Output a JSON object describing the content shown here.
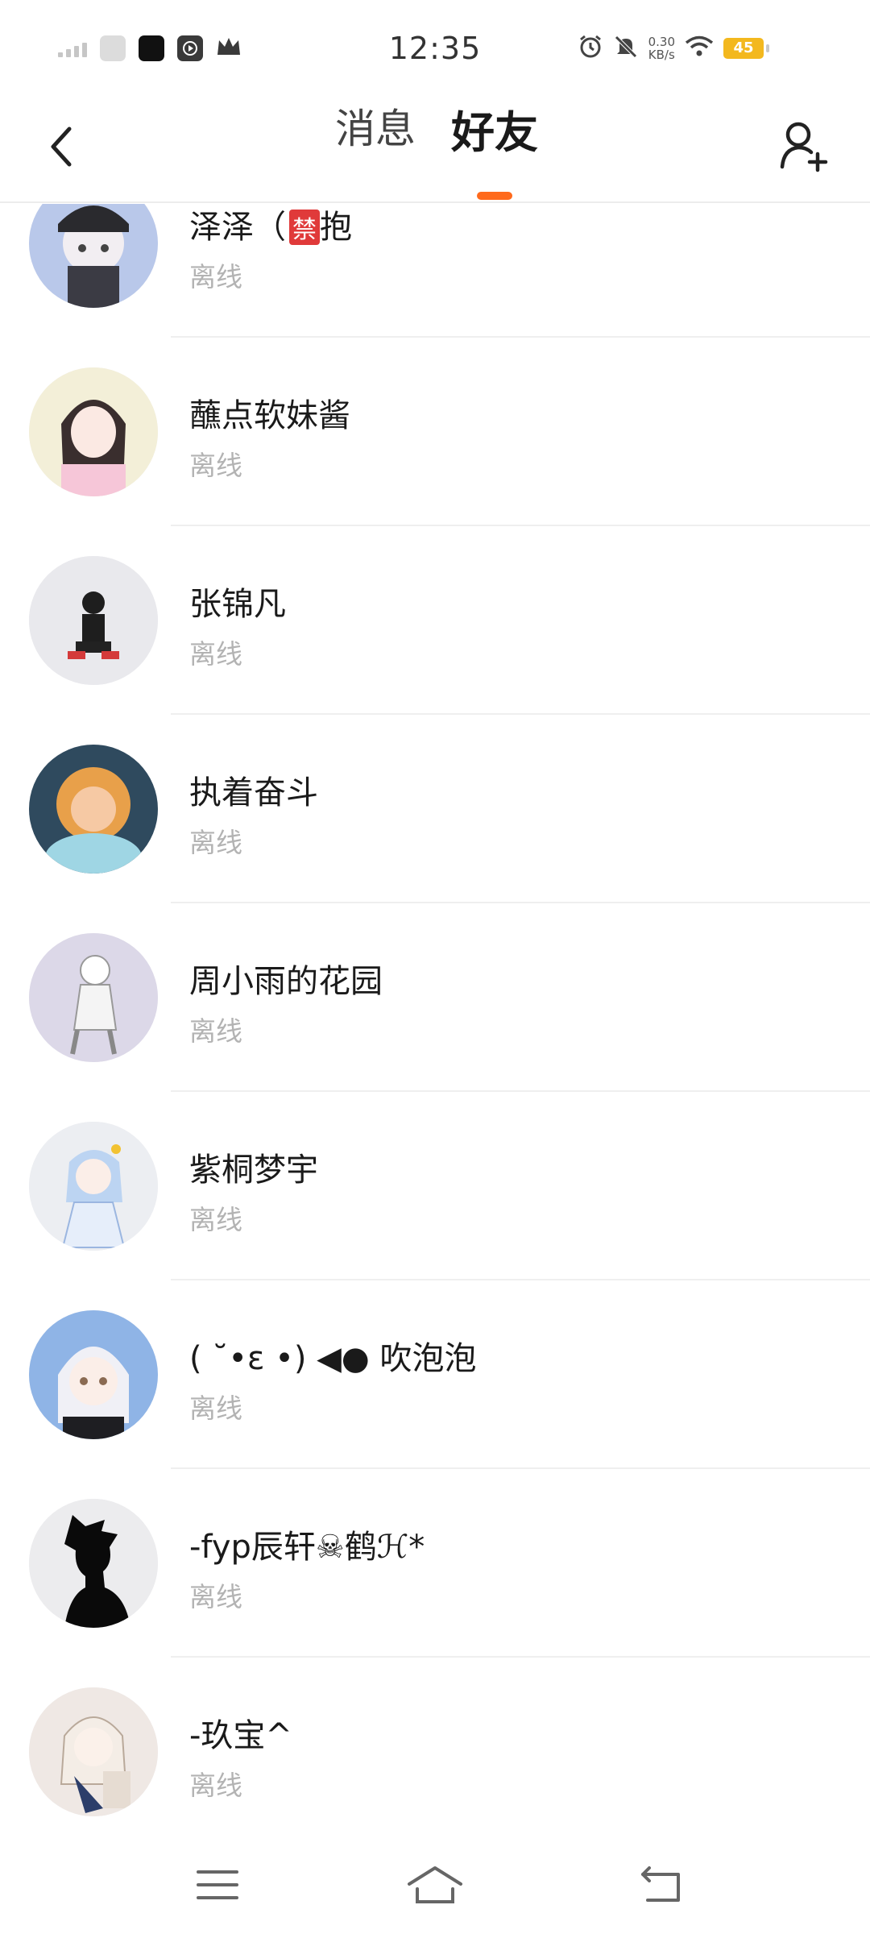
{
  "status_bar": {
    "time": "12:35",
    "net_speed_value": "0.30",
    "net_speed_unit": "KB/s",
    "battery": "45"
  },
  "header": {
    "back_icon": "chevron-left-icon",
    "tabs": [
      {
        "label": "消息",
        "active": false
      },
      {
        "label": "好友",
        "active": true
      }
    ],
    "add_friend_icon": "add-user-icon",
    "accent_color": "#ff6a1c"
  },
  "friends": [
    {
      "name": "泽泽（",
      "tag": "禁",
      "name_suffix": "抱",
      "status": "离线"
    },
    {
      "name": "蘸点软妹酱",
      "status": "离线"
    },
    {
      "name": "张锦凡",
      "status": "离线"
    },
    {
      "name": "执着奋斗",
      "status": "离线"
    },
    {
      "name": "周小雨的花园",
      "status": "离线"
    },
    {
      "name": "紫桐梦宇",
      "status": "离线"
    },
    {
      "name": "( ˘•ε •) ◀●  吹泡泡",
      "status": "离线"
    },
    {
      "name": "-fyp辰轩☠鹤ℋ*",
      "status": "离线"
    },
    {
      "name": "-玖宝^",
      "status": "离线"
    }
  ],
  "nav_bar": {
    "menu_icon": "menu-icon",
    "home_icon": "home-icon",
    "back_icon": "back-arrow-icon"
  }
}
